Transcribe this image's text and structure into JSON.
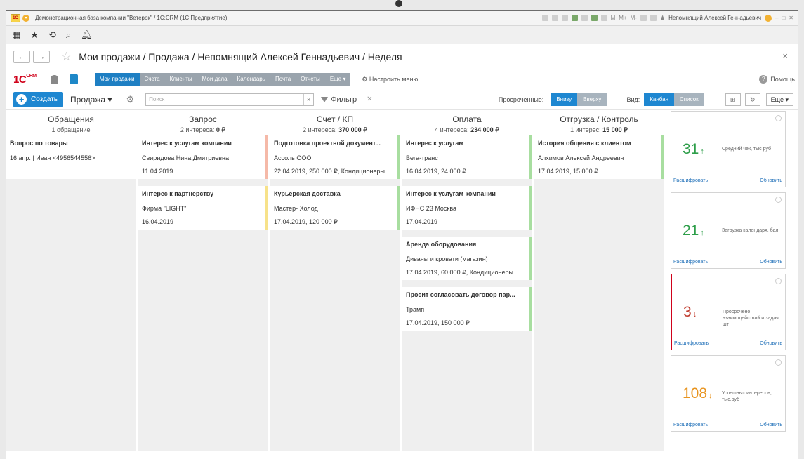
{
  "window": {
    "title": "Демонстрационная база компании \"Ветерок\" / 1С:CRM  (1С:Предприятие)",
    "logo_text": "1С",
    "user": "Непомнящий Алексей Геннадьевич",
    "m_labels": [
      "M",
      "M+",
      "M-"
    ],
    "min": "–",
    "max": "□",
    "close": "✕"
  },
  "toolbar": {
    "apps_icon": "▦",
    "star": "★",
    "history": "⟲",
    "search": "⌕",
    "bell": "♫"
  },
  "page": {
    "back": "←",
    "forward": "→",
    "star": "☆",
    "title": "Мои продажи / Продажа / Непомнящий Алексей Геннадьевич / Неделя",
    "close": "×"
  },
  "sections": {
    "logo": "1С",
    "logo_sup": "CRM",
    "items": [
      "Мои продажи",
      "Счета",
      "Клиенты",
      "Мои дела",
      "Календарь",
      "Почта",
      "Отчеты",
      "Еще ▾"
    ],
    "tune": "⚙ Настроить меню",
    "help": "Помощь",
    "help_icon": "?"
  },
  "command": {
    "create": "Создать",
    "create_icon": "+",
    "sale": "Продажа ▾",
    "gear": "⚙",
    "search_placeholder": "Поиск",
    "search_clear": "×",
    "filter": "Фильтр",
    "filter_clear": "✕",
    "overdue_label": "Просроченные:",
    "overdue_options": [
      "Внизу",
      "Вверху"
    ],
    "view_label": "Вид:",
    "view_options": [
      "Канбан",
      "Список"
    ],
    "grid_icon": "⊞",
    "refresh_icon": "↻",
    "more": "Еще ▾"
  },
  "columns": [
    {
      "name": "Обращения",
      "summary": "1 обращение",
      "summary_amount": "",
      "color": "#9e9e9e",
      "cards": [
        {
          "title": "Вопрос по товары",
          "line1": "16 апр. | Иван <4956544556>",
          "line2": "",
          "color": "#ffffff"
        }
      ]
    },
    {
      "name": "Запрос",
      "summary": "2 интереса: ",
      "summary_amount": "0 ₽",
      "color": "#6b6b3f",
      "cards": [
        {
          "title": "Интерес к услугам компании",
          "line1": "Свиридова Нина Дмитриевна",
          "line2": "11.04.2019",
          "color": "#f5b9a8"
        },
        {
          "title": "Интерес к партнерству",
          "line1": "Фирма \"LIGHT\"",
          "line2": "16.04.2019",
          "color": "#f7e28a"
        }
      ]
    },
    {
      "name": "Счет / КП",
      "summary": "2 интереса: ",
      "summary_amount": "370 000 ₽",
      "color": "#2f5f95",
      "cards": [
        {
          "title": "Подготовка проектной документ...",
          "line1": "Ассоль ООО",
          "line2": "22.04.2019, 250 000 ₽, Кондиционеры",
          "color": "#a8dea0"
        },
        {
          "title": "Курьерская доставка",
          "line1": "Мастер- Холод",
          "line2": "17.04.2019, 120 000 ₽",
          "color": "#a8dea0"
        }
      ]
    },
    {
      "name": "Оплата",
      "summary": "4 интереса: ",
      "summary_amount": "234 000 ₽",
      "color": "#9ad8c4",
      "cards": [
        {
          "title": "Интерес к услугам",
          "line1": "Вега-транс",
          "line2": "16.04.2019, 24 000 ₽",
          "color": "#a8dea0"
        },
        {
          "title": "Интерес к услугам компании",
          "line1": "ИФНС 23 Москва",
          "line2": "17.04.2019",
          "color": "#a8dea0"
        },
        {
          "title": "Аренда оборудования",
          "line1": "Диваны и кровати (магазин)",
          "line2": "17.04.2019, 60 000 ₽, Кондиционеры",
          "color": "#a8dea0"
        },
        {
          "title": "Просит согласовать договор пар...",
          "line1": "Трамп",
          "line2": "17.04.2019, 150 000 ₽",
          "color": "#a8dea0"
        }
      ]
    },
    {
      "name": "Отгрузка / Контроль",
      "summary": "1 интерес: ",
      "summary_amount": "15 000 ₽",
      "color": "#f2b24a",
      "cards": [
        {
          "title": "История общения с клиентом",
          "line1": "Алхимов Алексей Андреевич",
          "line2": "17.04.2019, 15 000 ₽",
          "color": "#a8dea0"
        }
      ]
    }
  ],
  "widgets": [
    {
      "value": "31",
      "arrow": "↑",
      "color": "#2e9e4a",
      "desc": "Средний чек, тыс руб",
      "left": "Расшифровать",
      "right": "Обновить",
      "alert": false
    },
    {
      "value": "21",
      "arrow": "↑",
      "color": "#2e9e4a",
      "desc": "Загрузка календаря, бал",
      "left": "Расшифровать",
      "right": "Обновить",
      "alert": false
    },
    {
      "value": "3",
      "arrow": "↓",
      "color": "#c0392b",
      "desc": "Просрочено взаимодействий и задач, шт",
      "left": "Расшифровать",
      "right": "Обновить",
      "alert": true
    },
    {
      "value": "108",
      "arrow": "↓",
      "color": "#e8941f",
      "desc": "Успешных интересов, тыс.руб",
      "left": "Расшифровать",
      "right": "Обновить",
      "alert": false
    }
  ]
}
